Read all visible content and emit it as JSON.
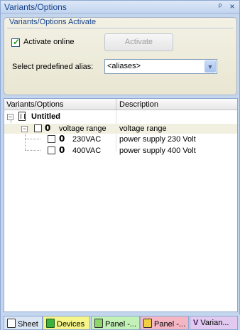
{
  "window": {
    "title": "Variants/Options",
    "pin_glyph": "ᵖ",
    "close_glyph": "×"
  },
  "activate_group": {
    "title": "Variants/Options Activate",
    "activate_online_label": "Activate online",
    "activate_online_checked": true,
    "activate_button": "Activate",
    "alias_label": "Select predefined alias:",
    "alias_value": "<aliases>"
  },
  "list": {
    "headers": {
      "variants": "Variants/Options",
      "description": "Description"
    },
    "rows": [
      {
        "name": "Untitled",
        "description": ""
      },
      {
        "name": "voltage range",
        "description": "voltage range"
      },
      {
        "name": "230VAC",
        "description": "power supply 230 Volt"
      },
      {
        "name": "400VAC",
        "description": "power supply 400 Volt"
      }
    ]
  },
  "tabs": [
    {
      "label": "Sheet"
    },
    {
      "label": "Devices"
    },
    {
      "label": "Panel -..."
    },
    {
      "label": "Panel -..."
    },
    {
      "label": "Varian..."
    }
  ],
  "colors": {
    "accent_title": "#15428b",
    "checkbox_check": "#21a121"
  }
}
